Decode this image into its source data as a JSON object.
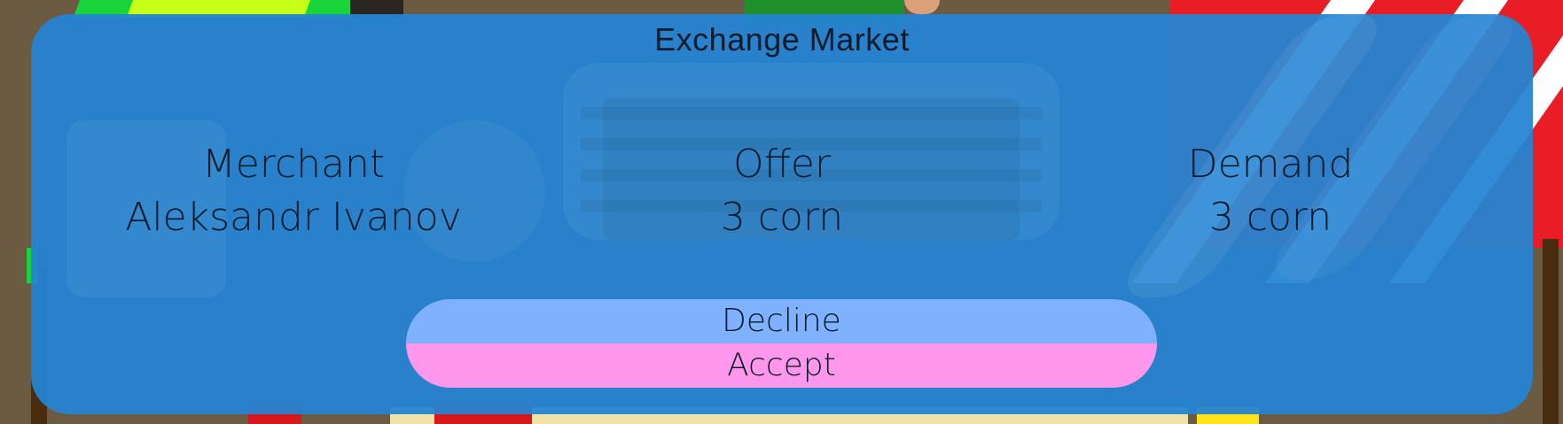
{
  "dialog": {
    "title": "Exchange Market",
    "merchant": {
      "label": "Merchant",
      "value": "Aleksandr Ivanov"
    },
    "offer": {
      "label": "Offer",
      "value": "3 corn"
    },
    "demand": {
      "label": "Demand",
      "value": "3 corn"
    },
    "buttons": {
      "decline": "Decline",
      "accept": "Accept"
    }
  },
  "colors": {
    "panel": "#2484d2",
    "decline_button": "#7fb1ff",
    "accept_button": "#ff97ec",
    "text": "#0b1b2b"
  }
}
